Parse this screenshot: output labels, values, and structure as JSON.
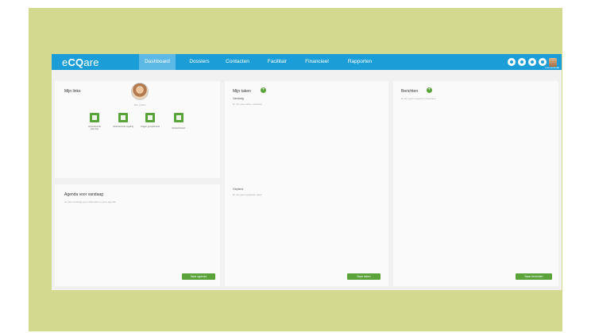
{
  "app": {
    "logo_pre": "e",
    "logo_mid": "CQ",
    "logo_post": "are",
    "user_name": "Lisa Verwaak"
  },
  "nav": [
    {
      "label": "Dashboard",
      "active": true
    },
    {
      "label": "Dossiers"
    },
    {
      "label": "Contacten"
    },
    {
      "label": "Facilitair"
    },
    {
      "label": "Financieel"
    },
    {
      "label": "Rapporten"
    }
  ],
  "header_icons": [
    "settings-icon",
    "mail-icon",
    "help-icon",
    "power-icon",
    "avatar"
  ],
  "links": {
    "title": "Mijn links",
    "profile_label": "Mijn profiel",
    "tiles": [
      {
        "label": "Verantwoorde planning",
        "icon": "calendar-icon"
      },
      {
        "label": "Verantwoorde regeling",
        "icon": "user-add-icon"
      },
      {
        "label": "Vragen geregistreerd",
        "icon": "settings-icon"
      },
      {
        "label": "Dossierbeheer",
        "icon": "folder-icon"
      }
    ]
  },
  "agenda": {
    "title": "Agenda voor vandaag",
    "empty": "Je hebt vandaag geen afspraken in jouw agenda",
    "button": "Naar agenda"
  },
  "tasks": {
    "title": "Mijn taken",
    "today_label": "Vandaag",
    "today_empty": "Er zijn geen taken vandaag",
    "planned_label": "Gepland",
    "planned_empty": "Er zijn geen geplande taken",
    "button": "Naar taken"
  },
  "messages": {
    "title": "Berichten",
    "empty": "Er zijn geen ongelezen berichten",
    "button": "Naar berichten"
  },
  "colors": {
    "frame": "#d3da8f",
    "topbar": "#1b9ed8",
    "accent": "#5aa23a"
  }
}
